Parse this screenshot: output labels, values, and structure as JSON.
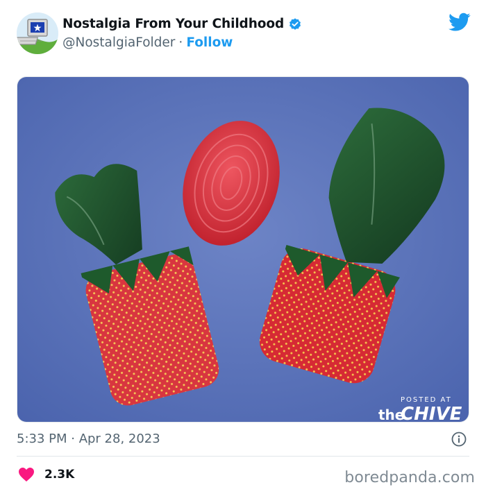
{
  "tweet": {
    "display_name": "Nostalgia From Your Childhood",
    "handle": "@NostalgiaFolder",
    "separator": "·",
    "follow_label": "Follow",
    "timestamp": "5:33 PM · Apr 28, 2023",
    "like_count": "2.3K",
    "colors": {
      "accent": "#1d9bf0",
      "like": "#f91880",
      "text_muted": "#536471"
    },
    "icons": {
      "verified": "verified-badge-icon",
      "platform": "twitter-bird-icon",
      "info": "info-icon",
      "like": "heart-icon"
    }
  },
  "photo": {
    "watermark_small": "POSTED AT",
    "watermark_the": "the",
    "watermark_chive": "CHIVE"
  },
  "page": {
    "source_watermark": "boredpanda.com"
  }
}
